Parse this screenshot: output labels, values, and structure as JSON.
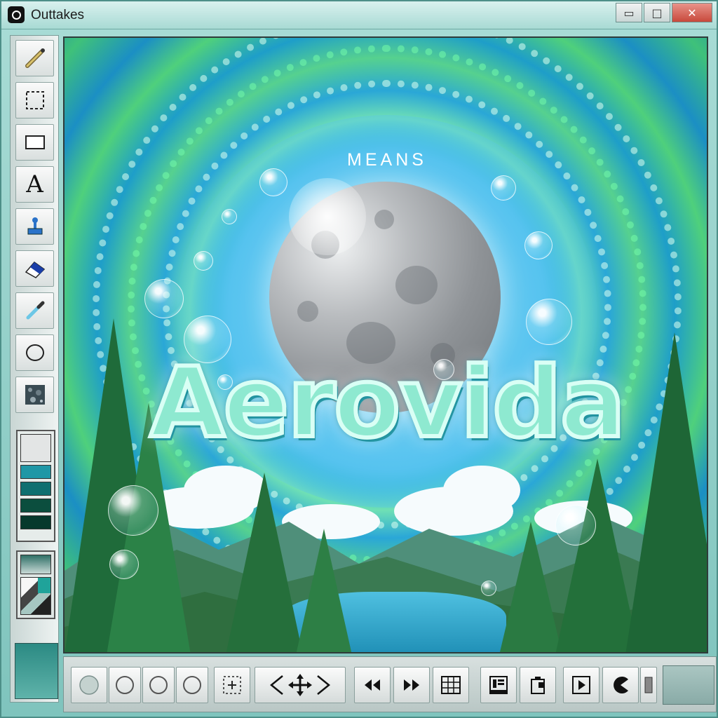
{
  "window": {
    "title": "Outtakes",
    "minimize_glyph": "▭",
    "maximize_glyph": "□",
    "close_glyph": "✕"
  },
  "tools": [
    {
      "name": "pencil-icon"
    },
    {
      "name": "marquee-select-icon"
    },
    {
      "name": "rectangle-icon"
    },
    {
      "name": "text-tool-icon",
      "label": "A"
    },
    {
      "name": "stamp-icon"
    },
    {
      "name": "eraser-icon"
    },
    {
      "name": "eyedropper-icon"
    },
    {
      "name": "ellipse-icon"
    },
    {
      "name": "texture-icon"
    }
  ],
  "palette": {
    "swatches": [
      "#d9dcdc",
      "#1f97a6",
      "#0f6f70",
      "#0b4e3e",
      "#06392c"
    ]
  },
  "canvas": {
    "subtitle": "MEANS",
    "title": "Aerovida"
  },
  "bottom_tools": [
    "circle-solid-icon",
    "circle-outline-icon",
    "circle-outline-icon",
    "circle-outline-icon",
    "selection-move-icon",
    "transform-arrows-icon",
    "rewind-icon",
    "fast-forward-icon",
    "grid-icon",
    "layout-icon",
    "clipboard-icon",
    "play-icon",
    "pacman-icon",
    "slider-icon"
  ],
  "colors": {
    "title_bar": "#a8dad4",
    "accent_teal": "#2b8a83",
    "close_red": "#c8493b"
  }
}
